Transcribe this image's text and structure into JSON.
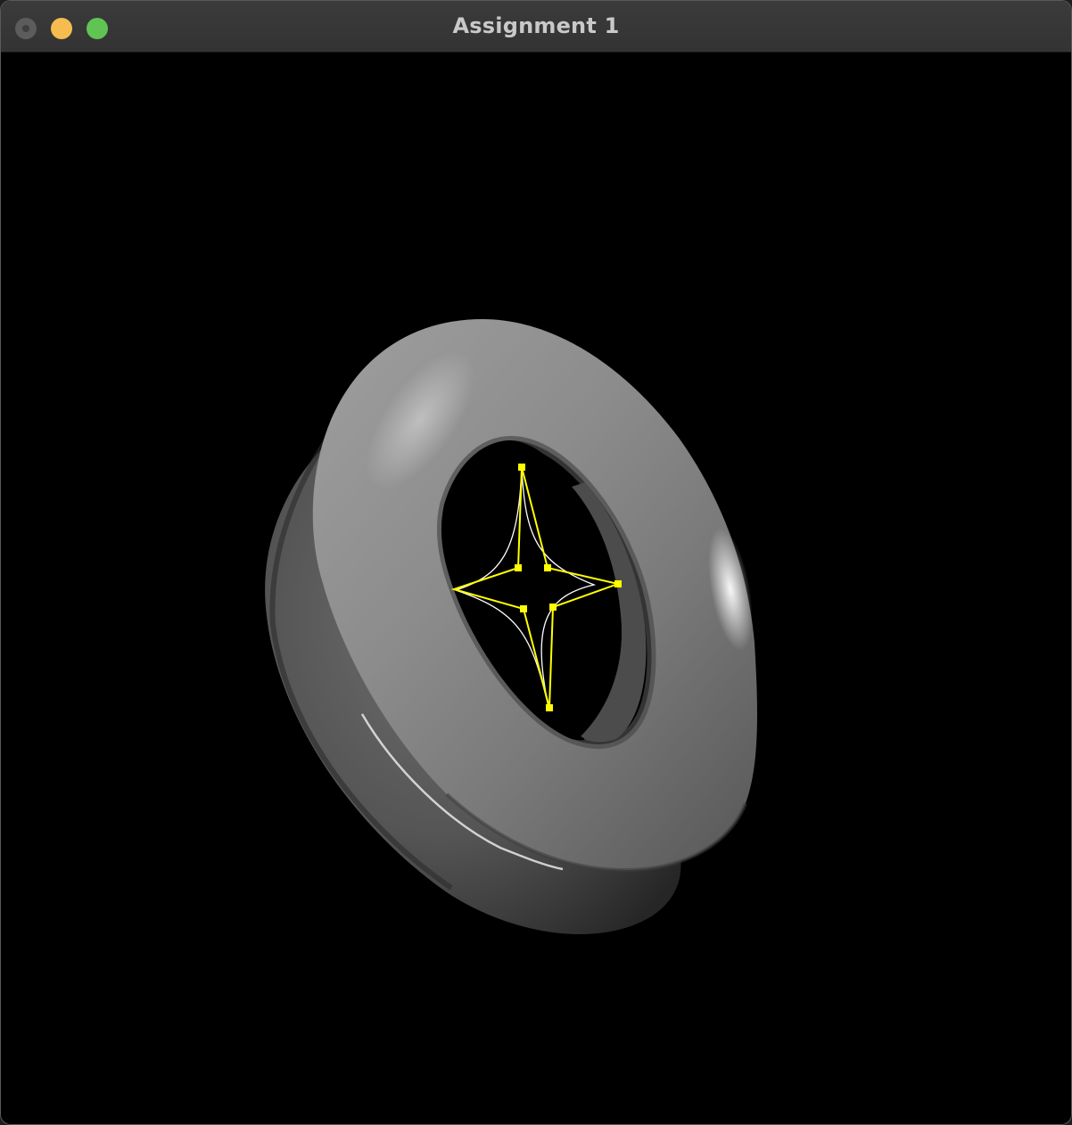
{
  "window": {
    "title": "Assignment 1",
    "controls": {
      "close_icon": "close-icon",
      "minimize_icon": "minimize-icon",
      "maximize_icon": "maximize-icon",
      "close_color": "#5c5c5c",
      "minimize_color": "#f5bd4f",
      "maximize_color": "#5fc454"
    }
  },
  "scene": {
    "background_color": "#000000",
    "surface": "swept-torus",
    "surface_color": "#8a8a8a",
    "curve_color": "#ffff00",
    "control_point_color": "#ffff00",
    "spline_color": "#ffffff"
  }
}
